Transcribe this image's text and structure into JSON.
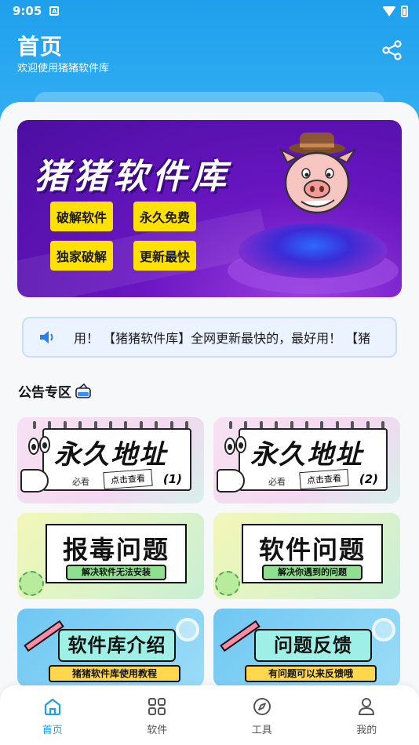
{
  "status_bar": {
    "time": "9:05",
    "notification_icon": "a-icon",
    "wifi_icon": "wifi-icon",
    "battery_icon": "battery-icon"
  },
  "header": {
    "title": "首页",
    "subtitle": "欢迎使用猪猪软件库",
    "share_icon": "share-icon",
    "color": "#1fa0ec"
  },
  "banner": {
    "title": "猪猪软件库",
    "tags": [
      "破解软件",
      "永久免费",
      "独家破解",
      "更新最快"
    ]
  },
  "notice": {
    "icon": "speaker-icon",
    "text": "用！   【猪猪软件库】全网更新最快的，最好用！   【猪"
  },
  "section": {
    "title": "公告专区"
  },
  "cards": [
    {
      "big": "永久地址",
      "small": "必看",
      "pill": "点击查看",
      "num": "(1)"
    },
    {
      "big": "永久地址",
      "small": "必看",
      "pill": "点击查看",
      "num": "(2)"
    },
    {
      "big": "报毒问题",
      "sub": "解决软件无法安装"
    },
    {
      "big": "软件问题",
      "sub": "解决你遇到的问题"
    },
    {
      "big": "软件库介绍",
      "sub": "猪猪软件库使用教程"
    },
    {
      "big": "问题反馈",
      "sub": "有问题可以来反馈哦"
    }
  ],
  "tabbar": {
    "active_color": "#1f9fea",
    "items": [
      {
        "label": "首页",
        "icon": "home-icon",
        "active": true
      },
      {
        "label": "软件",
        "icon": "grid-icon",
        "active": false
      },
      {
        "label": "工具",
        "icon": "compass-icon",
        "active": false
      },
      {
        "label": "我的",
        "icon": "user-icon",
        "active": false
      }
    ]
  }
}
